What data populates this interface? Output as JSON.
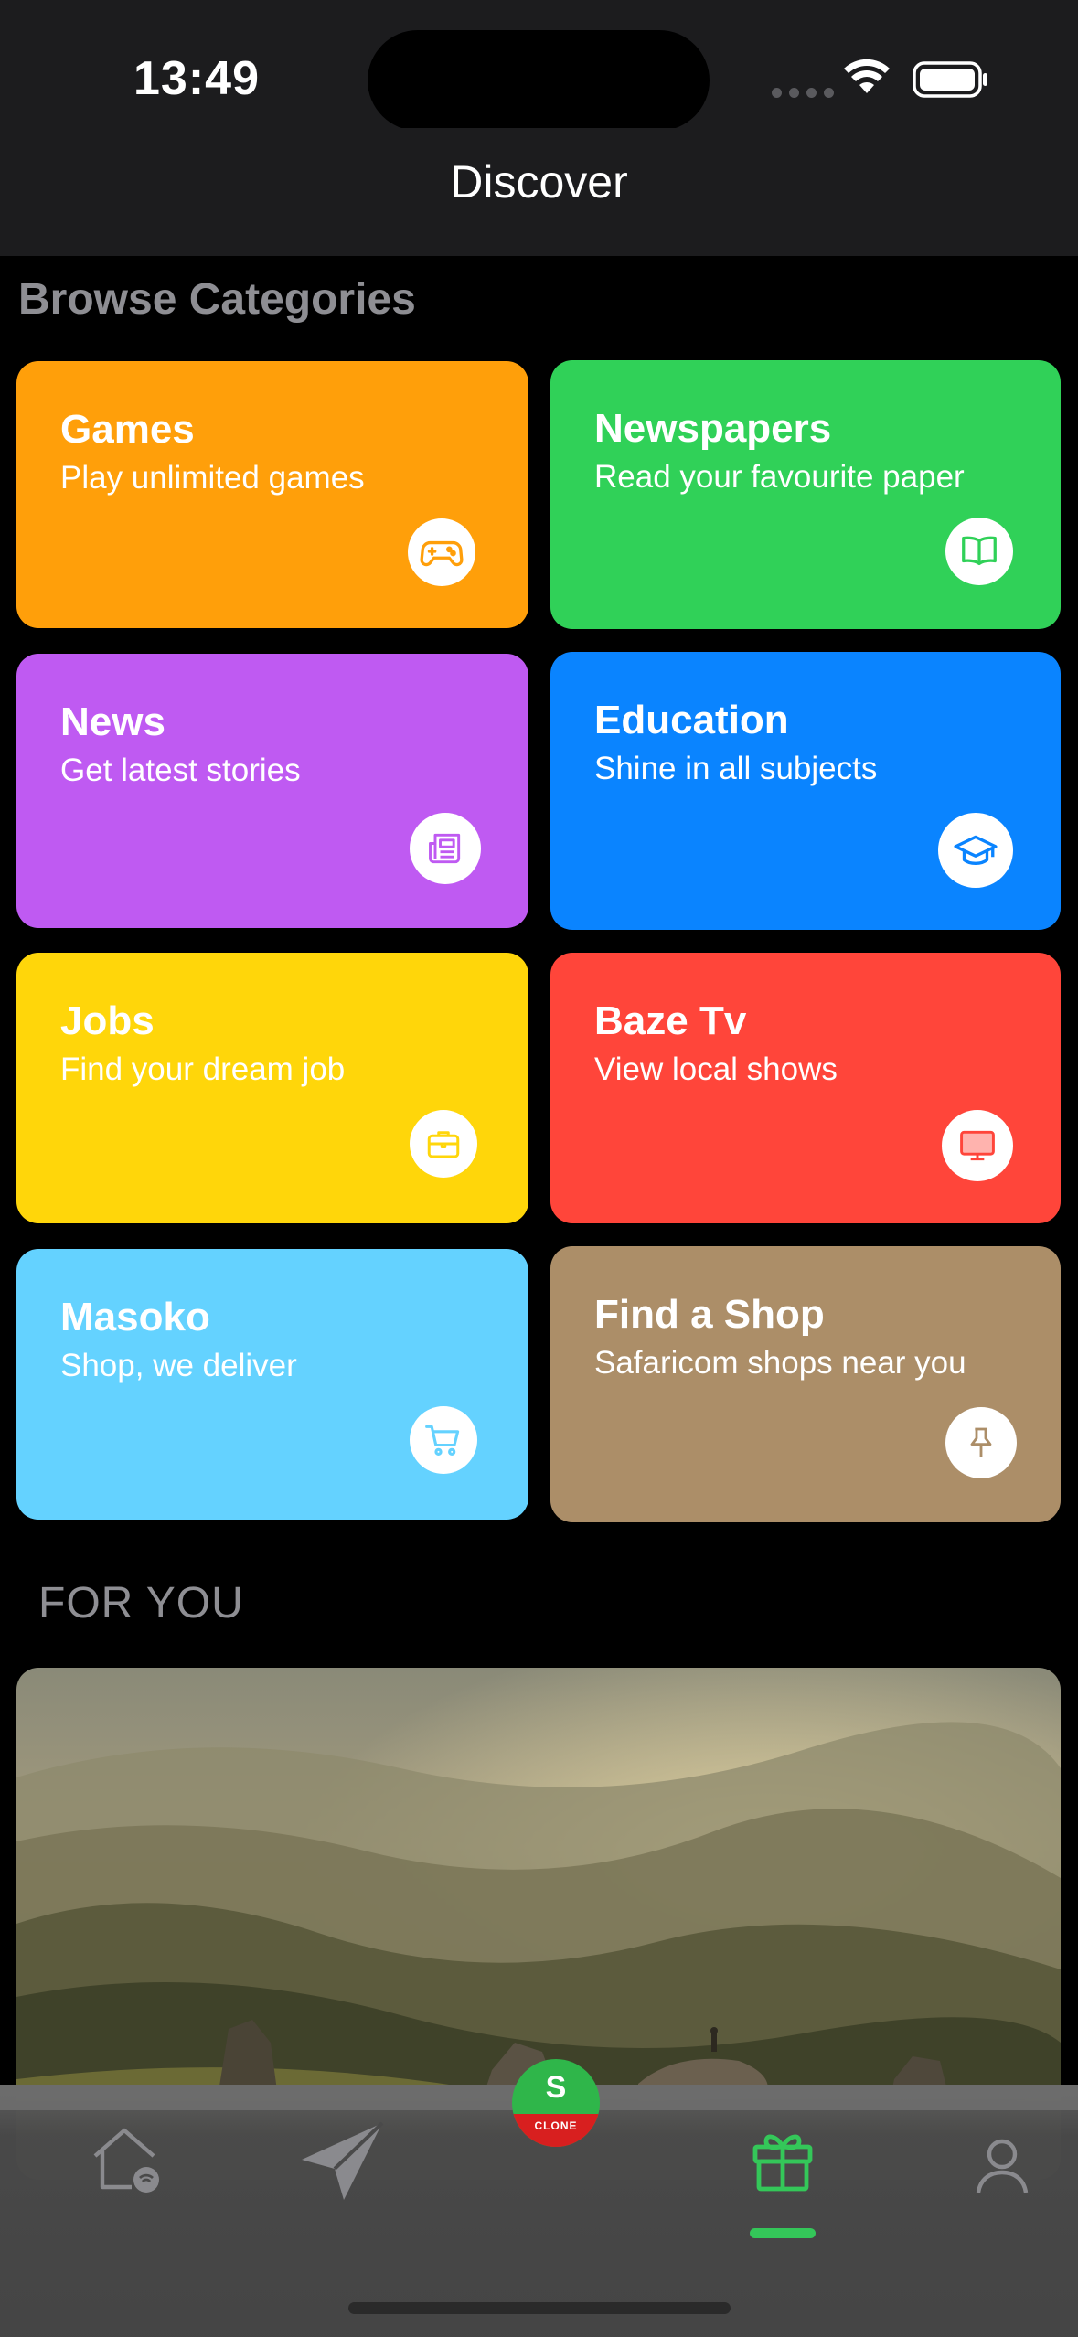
{
  "status_bar": {
    "time": "13:49"
  },
  "nav": {
    "title": "Discover"
  },
  "browse": {
    "section_title": "Browse Categories"
  },
  "categories": [
    {
      "title": "Games",
      "subtitle": "Play unlimited games",
      "color": "#ff9f0a",
      "icon": "gamepad-icon"
    },
    {
      "title": "Newspapers",
      "subtitle": "Read your favourite paper",
      "color": "#30d158",
      "icon": "book-icon"
    },
    {
      "title": "News",
      "subtitle": "Get latest stories",
      "color": "#bf5af2",
      "icon": "newspaper-icon"
    },
    {
      "title": "Education",
      "subtitle": "Shine in all subjects",
      "color": "#0a84ff",
      "icon": "graduation-cap-icon"
    },
    {
      "title": "Jobs",
      "subtitle": "Find your dream job",
      "color": "#ffd60a",
      "icon": "briefcase-icon"
    },
    {
      "title": "Baze Tv",
      "subtitle": "View local shows",
      "color": "#ff453a",
      "icon": "tv-icon"
    },
    {
      "title": "Masoko",
      "subtitle": "Shop, we deliver",
      "color": "#64d2ff",
      "icon": "cart-icon"
    },
    {
      "title": "Find a Shop",
      "subtitle": "Safaricom shops near you",
      "color": "#ac8e68",
      "icon": "pin-icon"
    }
  ],
  "for_you": {
    "section_title": "FOR YOU"
  },
  "tab_bar": {
    "tabs": [
      {
        "name": "home",
        "icon": "home-wifi-icon",
        "active": false
      },
      {
        "name": "send",
        "icon": "send-icon",
        "active": false
      },
      {
        "name": "discover",
        "icon": "gift-icon",
        "active": true
      },
      {
        "name": "account",
        "icon": "person-icon",
        "active": false
      }
    ],
    "fab": {
      "letter": "S",
      "label": "CLONE"
    },
    "active_color": "#34c759"
  }
}
